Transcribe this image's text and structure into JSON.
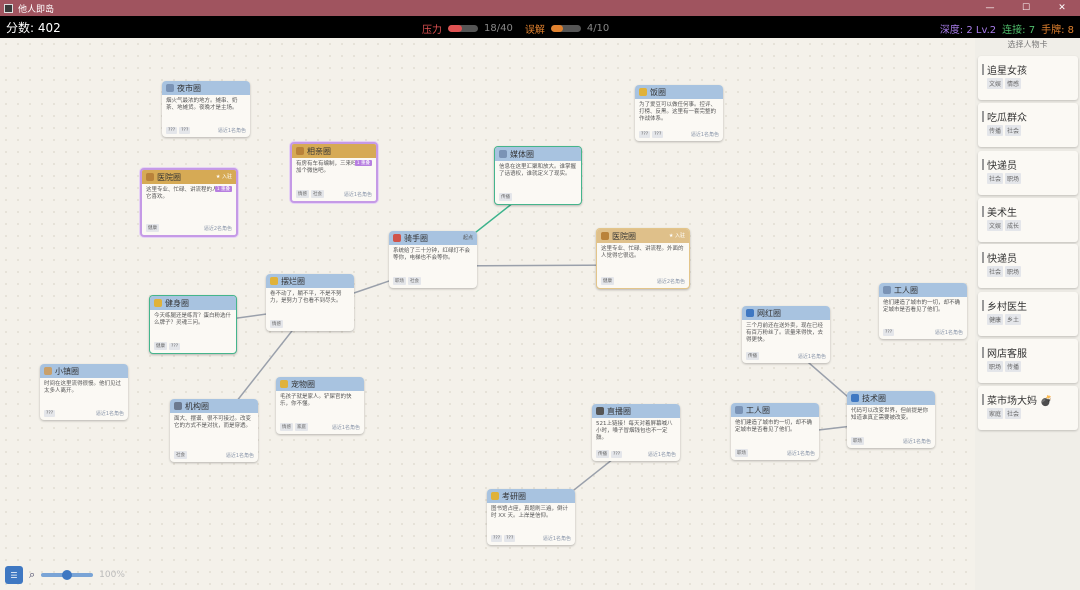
{
  "window": {
    "title": "他人即岛"
  },
  "hud": {
    "score_text": "分数: 402",
    "pressure": {
      "label": "压力",
      "value_text": "18/40",
      "fraction": 0.45,
      "color": "#e05252"
    },
    "relief": {
      "label": "误解",
      "value_text": "4/10",
      "fraction": 0.4,
      "color": "#e0812e"
    },
    "depth_text": "深度: 2 Lv.2",
    "combo_text": "连接: 7",
    "hand_text": "手牌: 8"
  },
  "colors": {
    "depth": "#a77ce8",
    "combo": "#4fbf6c",
    "hand": "#e0812e"
  },
  "cards": [
    {
      "id": "night-market",
      "title": "夜市圈",
      "icon": "market-icon",
      "desc": "烟火气最浓的地方。摊串、奶茶、地摊货。夜晚才是主场。",
      "tags": [
        "???",
        "???"
      ],
      "summary": "逼近1名角色"
    },
    {
      "id": "blind-date",
      "title": "相亲圈",
      "icon": "heart-icon",
      "desc": "有房有车有编制，三来吗？先加个微信吧。",
      "badge": "1 重叠",
      "tags": [
        "情感",
        "社会"
      ],
      "summary": "逼近1名角色"
    },
    {
      "id": "hospital-1",
      "title": "医院圈",
      "icon": "hospital-icon",
      "flag": "★ 入驻",
      "desc": "这里专业、忙碌、讲流程的人最让它喜欢。",
      "badge": "1 重叠",
      "tags": [
        "健康"
      ],
      "summary": "逼近2名角色"
    },
    {
      "id": "media",
      "title": "媒体圈",
      "icon": "media-icon",
      "desc": "信息在这里汇聚和放大。谁掌握了话语权，谁就定义了现实。",
      "tags": [
        "传播"
      ],
      "summary": ""
    },
    {
      "id": "food",
      "title": "饭圈",
      "icon": "star-icon",
      "desc": "为了爱豆可以做任何事。控评、打榜、反黑。这里有一套完整的作战体系。",
      "tags": [
        "???",
        "???"
      ],
      "summary": "逼近1名角色"
    },
    {
      "id": "rider",
      "title": "骑手圈",
      "icon": "scooter-icon",
      "flag": "起点",
      "desc": "系统给了三十分钟，红绿灯不会等你，电梯也不会等你。",
      "tags": [
        "职场",
        "社会"
      ],
      "summary": ""
    },
    {
      "id": "hospital-2",
      "title": "医院圈",
      "icon": "hospital-icon",
      "flag": "★ 入驻",
      "desc": "这里专业、忙碌、讲流程。外面的人觉得它很远。",
      "tags": [
        "健康"
      ],
      "summary": "逼近2名角色"
    },
    {
      "id": "lying-flat",
      "title": "摆烂圈",
      "icon": "face-icon",
      "desc": "卷不动了，躺不平，不是不努力，是努力了也看不到尽头。",
      "tags": [
        "情感"
      ],
      "summary": ""
    },
    {
      "id": "fitness",
      "title": "健身圈",
      "icon": "muscle-icon",
      "desc": "今天练腿还是练背？蛋白粉选什么牌子？灵魂三问。",
      "tags": [
        "健康",
        "???"
      ],
      "summary": ""
    },
    {
      "id": "worker",
      "title": "工人圈",
      "icon": "worker-icon",
      "desc": "他们建造了城市的一切，却不确定城市是否看见了他们。",
      "tags": [
        "???"
      ],
      "summary": "逼近1名角色"
    },
    {
      "id": "influencer",
      "title": "网红圈",
      "icon": "phone-icon",
      "desc": "三个月前还在送外卖，现在已经有百万粉丝了。流量来得快，去得更快。",
      "tags": [
        "传播"
      ],
      "summary": "逼近1名角色"
    },
    {
      "id": "small-town",
      "title": "小镇圈",
      "icon": "house-icon",
      "desc": "时间在这里流得很慢。他们见过太多人离开。",
      "tags": [
        "???"
      ],
      "summary": "逼近1名角色"
    },
    {
      "id": "institution",
      "title": "机构圈",
      "icon": "building-icon",
      "desc": "面大、摆谱、很不可接过。改变它的方式不是对抗，而是穿透。",
      "tags": [
        "社会"
      ],
      "summary": "逼近1名角色"
    },
    {
      "id": "pets",
      "title": "宠物圈",
      "icon": "paw-icon",
      "desc": "毛孩子就是家人。铲屎官的快乐，你不懂。",
      "tags": [
        "情感",
        "家庭"
      ],
      "summary": "逼近1名角色"
    },
    {
      "id": "livestream",
      "title": "直播圈",
      "icon": "camera-icon",
      "desc": "521上链接！每天对着屏幕喊八小时，嗓子冒烟钱包也不一定鼓。",
      "tags": [
        "传播",
        "???"
      ],
      "summary": "逼近1名角色"
    },
    {
      "id": "worker-2",
      "title": "工人圈",
      "icon": "worker-icon",
      "desc": "他们建造了城市的一切，却不确定城市是否看见了他们。",
      "tags": [
        "职场"
      ],
      "summary": "逼近1名角色"
    },
    {
      "id": "tech",
      "title": "技术圈",
      "icon": "laptop-icon",
      "desc": "代码可以改变世界，但前提是你知道谁真正需要被改变。",
      "tags": [
        "职场"
      ],
      "summary": "逼近1名角色"
    },
    {
      "id": "exam",
      "title": "考研圈",
      "icon": "note-icon",
      "desc": "图书馆占座，真题刷三遍，倒计时 XX 天。上岸是信仰。",
      "tags": [
        "???",
        "???"
      ],
      "summary": "逼近1名角色"
    }
  ],
  "sidebar": {
    "title": "选择人物卡",
    "characters": [
      {
        "name": "追星女孩",
        "tags": [
          "文娱",
          "情感"
        ]
      },
      {
        "name": "吃瓜群众",
        "tags": [
          "传播",
          "社会"
        ]
      },
      {
        "name": "快递员",
        "tags": [
          "社会",
          "职场"
        ]
      },
      {
        "name": "美术生",
        "tags": [
          "文娱",
          "成长"
        ]
      },
      {
        "name": "快递员",
        "tags": [
          "社会",
          "职场"
        ]
      },
      {
        "name": "乡村医生",
        "tags": [
          "健康",
          "乡土"
        ]
      },
      {
        "name": "网店客服",
        "tags": [
          "职场",
          "传播"
        ]
      },
      {
        "name": "菜市场大妈 💣",
        "tags": [
          "家庭",
          "社会"
        ]
      }
    ]
  },
  "toolbar": {
    "menu_icon": "menu-icon",
    "search_icon": "magnifier-icon",
    "zoom_text": "100%",
    "zoom_fraction": 0.5
  }
}
